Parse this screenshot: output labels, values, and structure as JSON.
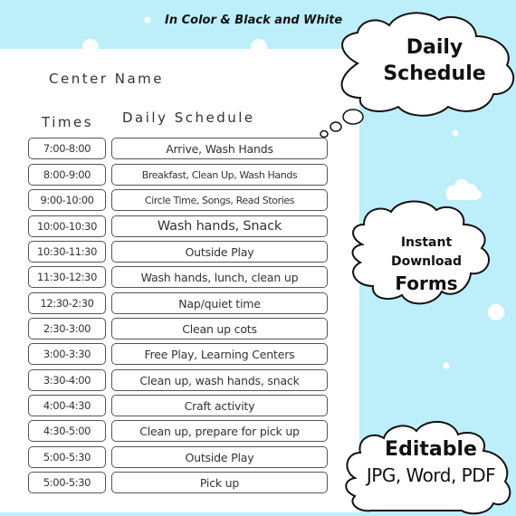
{
  "tagline": "In Color & Black and White",
  "center_name_label": "Center Name",
  "headers": {
    "times": "Times",
    "schedule": "Daily Schedule"
  },
  "schedule": [
    {
      "time": "7:00-8:00",
      "activity": "Arrive, Wash Hands"
    },
    {
      "time": "8:00-9:00",
      "activity": "Breakfast, Clean Up, Wash Hands"
    },
    {
      "time": "9:00-10:00",
      "activity": "Circle Time, Songs, Read Stories"
    },
    {
      "time": "10:00-10:30",
      "activity": "Wash hands, Snack"
    },
    {
      "time": "10:30-11:30",
      "activity": "Outside Play"
    },
    {
      "time": "11:30-12:30",
      "activity": "Wash hands, lunch, clean up"
    },
    {
      "time": "12:30-2:30",
      "activity": "Nap/quiet time"
    },
    {
      "time": "2:30-3:00",
      "activity": "Clean up cots"
    },
    {
      "time": "3:00-3:30",
      "activity": "Free Play, Learning Centers"
    },
    {
      "time": "3:30-4:00",
      "activity": "Clean up, wash hands, snack"
    },
    {
      "time": "4:00-4:30",
      "activity": "Craft activity"
    },
    {
      "time": "4:30-5:00",
      "activity": "Clean up, prepare for pick up"
    },
    {
      "time": "5:00-5:30",
      "activity": "Outside Play"
    },
    {
      "time": "5:00-5:30",
      "activity": "Pick up"
    }
  ],
  "clouds": {
    "title": {
      "line1": "Daily",
      "line2": "Schedule"
    },
    "download": {
      "line1": "Instant",
      "line2": "Download",
      "line3": "Forms"
    },
    "editable": {
      "line1": "Editable",
      "line2": "JPG, Word, PDF"
    }
  },
  "colors": {
    "background": "#bdeffb",
    "panel": "#ffffff",
    "outline": "#111111",
    "box_border": "#555555"
  }
}
